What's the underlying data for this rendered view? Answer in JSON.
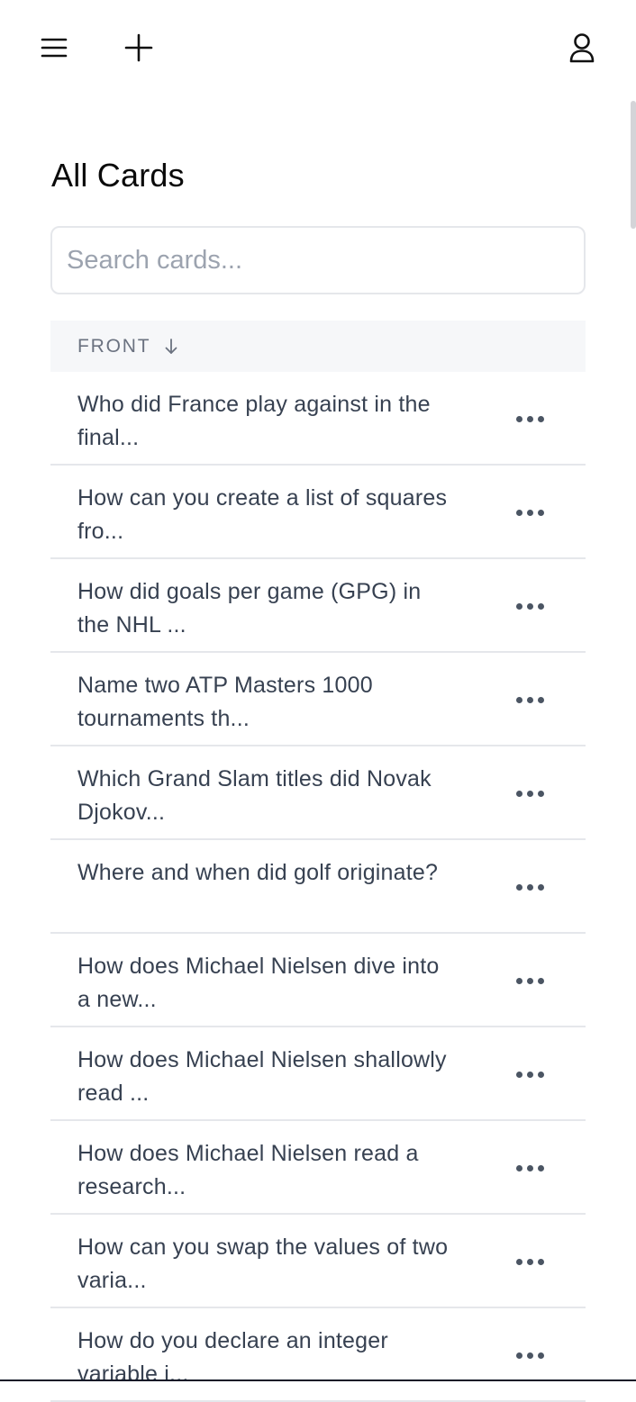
{
  "header": {
    "menu_icon": "hamburger-menu-icon",
    "add_icon": "plus-icon",
    "profile_icon": "user-icon"
  },
  "main": {
    "title": "All Cards",
    "search": {
      "placeholder": "Search cards...",
      "value": ""
    },
    "table": {
      "columns": [
        {
          "label": "FRONT",
          "sort": "descending",
          "sort_icon": "arrow-down-icon"
        }
      ],
      "rows": [
        {
          "front": "Who did France play against in the final..."
        },
        {
          "front": "How can you create a list of squares fro..."
        },
        {
          "front": "How did goals per game (GPG) in the NHL ..."
        },
        {
          "front": "Name two ATP Masters 1000 tournaments th..."
        },
        {
          "front": "Which Grand Slam titles did Novak Djokov..."
        },
        {
          "front": "Where and when did golf originate?"
        },
        {
          "front": "How does Michael Nielsen dive into a new..."
        },
        {
          "front": "How does Michael Nielsen shallowly read ..."
        },
        {
          "front": "How does Michael Nielsen read a research..."
        },
        {
          "front": "How can you swap the values of two varia..."
        },
        {
          "front": "How do you declare an integer variable i..."
        }
      ],
      "row_action_icon": "more-horizontal-icon"
    }
  },
  "colors": {
    "text": "#111827",
    "row_text": "#374151",
    "muted": "#6b7280",
    "header_bg": "#f6f7f9",
    "border": "#e5e7eb"
  }
}
